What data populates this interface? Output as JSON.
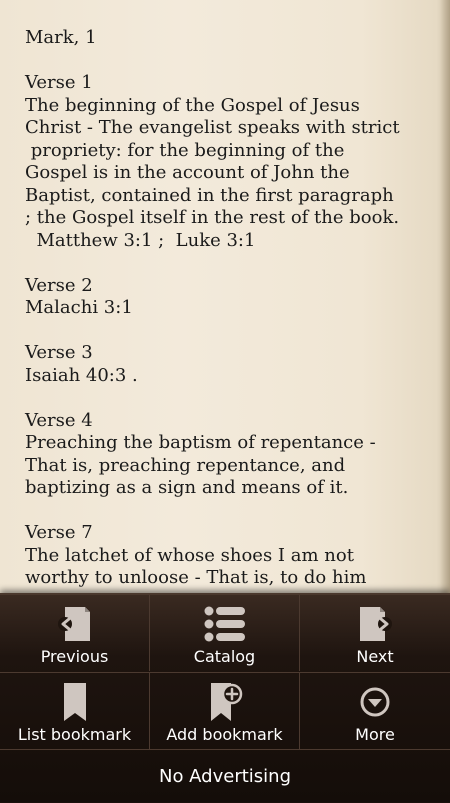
{
  "reader": {
    "chapter_title": "Mark, 1",
    "verses": [
      {
        "heading": "Verse 1",
        "lines": [
          "The beginning of the Gospel of Jesus",
          "Christ - The evangelist speaks with strict",
          " propriety: for the beginning of the",
          "Gospel is in the account of John the",
          "Baptist, contained in the first paragraph",
          "; the Gospel itself in the rest of the book.",
          "  Matthew 3:1 ;  Luke 3:1"
        ]
      },
      {
        "heading": "Verse 2",
        "lines": [
          "Malachi 3:1"
        ]
      },
      {
        "heading": "Verse 3",
        "lines": [
          "Isaiah 40:3 ."
        ]
      },
      {
        "heading": "Verse 4",
        "lines": [
          "Preaching the baptism of repentance -",
          "That is, preaching repentance, and",
          "baptizing as a sign and means of it."
        ]
      },
      {
        "heading": "Verse 7",
        "lines": [
          "The latchet of whose shoes I am not",
          "worthy to unloose - That is, to do him"
        ]
      }
    ]
  },
  "menu": {
    "previous": {
      "label": "Previous",
      "icon": "page-previous-icon"
    },
    "catalog": {
      "label": "Catalog",
      "icon": "list-icon"
    },
    "next": {
      "label": "Next",
      "icon": "page-next-icon"
    },
    "list_bookmark": {
      "label": "List bookmark",
      "icon": "bookmark-icon"
    },
    "add_bookmark": {
      "label": "Add bookmark",
      "icon": "bookmark-add-icon"
    },
    "more": {
      "label": "More",
      "icon": "chevron-down-circle-icon"
    },
    "no_ads": {
      "label": "No Advertising"
    }
  },
  "colors": {
    "paper": "#f1e8d8",
    "menu_bg": "#1c120d",
    "icon": "#cfc6c0",
    "text": "#1a1a1a"
  }
}
